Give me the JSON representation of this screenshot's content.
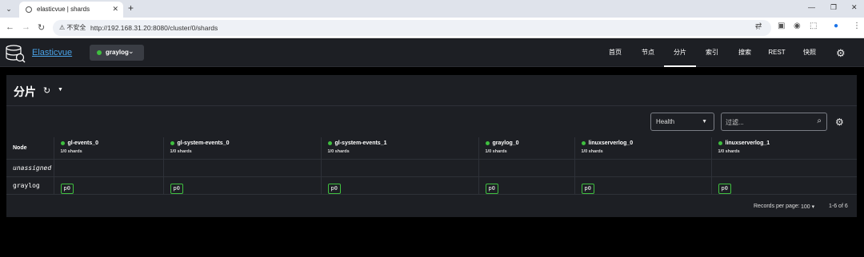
{
  "browser": {
    "tab_title": "elasticvue | shards",
    "url_warning": "不安全",
    "url": "http://192.168.31.20:8080/cluster/0/shards"
  },
  "app": {
    "brand": "Elasticvue",
    "cluster_name": "graylog",
    "nav": [
      "首页",
      "节点",
      "分片",
      "索引",
      "搜索",
      "REST",
      "快照"
    ],
    "active_nav": "分片"
  },
  "page": {
    "title": "分片",
    "health_select": "Health",
    "filter_placeholder": "过滤..."
  },
  "table": {
    "node_header": "Node",
    "indices": [
      {
        "name": "gl-events_0",
        "count": "1/0 shards"
      },
      {
        "name": "gl-system-events_0",
        "count": "1/0 shards"
      },
      {
        "name": "gl-system-events_1",
        "count": "1/0 shards"
      },
      {
        "name": "graylog_0",
        "count": "1/0 shards"
      },
      {
        "name": "linuxserverlog_0",
        "count": "1/0 shards"
      },
      {
        "name": "linuxserverlog_1",
        "count": "1/0 shards"
      }
    ],
    "rows": [
      {
        "node": "unassigned",
        "shards": [
          "",
          "",
          "",
          "",
          "",
          ""
        ]
      },
      {
        "node": "graylog",
        "shards": [
          "p0",
          "p0",
          "p0",
          "p0",
          "p0",
          "p0"
        ]
      }
    ]
  },
  "footer": {
    "records_label": "Records per page:",
    "per_page": "100",
    "range": "1-6 of 6"
  },
  "colors": {
    "accent_green": "#3fbf3f",
    "brand_blue": "#4aa3e8",
    "panel_bg": "#1d1f24"
  }
}
